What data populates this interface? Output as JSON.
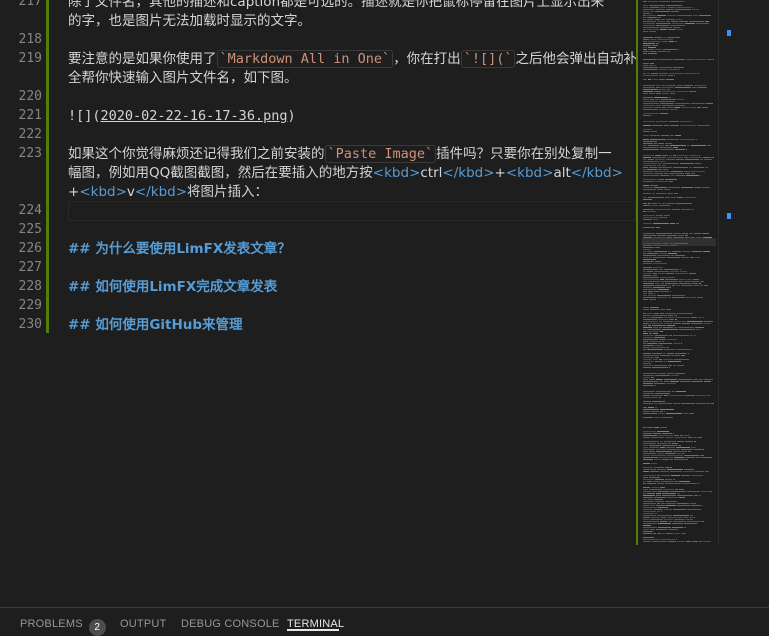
{
  "editor": {
    "line_numbers": [
      "217",
      "218",
      "219",
      "220",
      "221",
      "222",
      "223",
      "224",
      "225",
      "226",
      "227",
      "228",
      "229",
      "230"
    ],
    "lines": {
      "l217": "除了文件名，其他的描述和caption都是可选的。描述就是你把鼠标停留在图片上显示出来",
      "l217b": "的字，也是图片无法加载时显示的文字。",
      "l219a": "要注意的是如果你使用了",
      "l219code1": "`Markdown All in One`",
      "l219b": "，你在打出",
      "l219code2": "`![](`",
      "l219c": "之后他会弹出自动补",
      "l219d": "全帮你快速输入图片文件名，如下图。",
      "l221a": "![](",
      "l221url": "2020-02-22-16-17-36.png",
      "l221b": ")",
      "l223a": "如果这个你觉得麻烦还记得我们之前安装的",
      "l223code": "`Paste Image`",
      "l223b": "插件吗？只要你在别处复制一",
      "l223c": "幅图，例如用QQ截图截图，然后在要插入的地方按",
      "kbd_open": "<kbd>",
      "kbd_close": "</kbd>",
      "key_ctrl": "ctrl",
      "plus": "+",
      "key_alt": "alt",
      "key_v": "v",
      "l223e": "将图片插入：",
      "h226": "## 为什么要使用LimFX发表文章？",
      "h228": "## 如何使用LimFX完成文章发表",
      "h230": "## 如何使用GitHub来管理"
    }
  },
  "panel": {
    "tabs": [
      {
        "label": "PROBLEMS",
        "badge": "2"
      },
      {
        "label": "OUTPUT"
      },
      {
        "label": "DEBUG CONSOLE"
      },
      {
        "label": "TERMINAL"
      }
    ]
  },
  "colors": {
    "background": "#1e1e1e",
    "line_number": "#858585",
    "git_modified": "#587c0c",
    "code_span": "#ce9178",
    "tag": "#569cd6",
    "heading": "#569cd6",
    "scroll_marker": "#3794ff"
  }
}
